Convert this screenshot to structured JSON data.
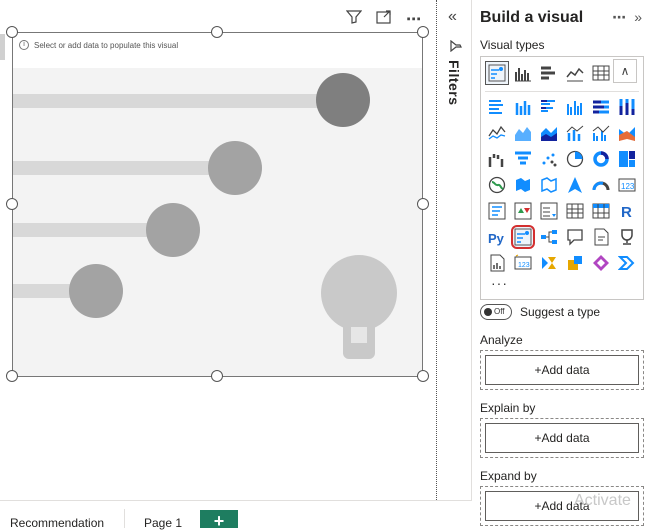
{
  "canvas": {
    "placeholder": "Select or add data to populate this visual",
    "toolbar_icons": [
      "filter-icon",
      "focus-mode-icon",
      "more-options-icon"
    ]
  },
  "filters": {
    "label": "Filters"
  },
  "panel": {
    "title": "Build a visual",
    "visual_types_label": "Visual types",
    "suggest_toggle_state": "Off",
    "suggest_label": "Suggest a type",
    "wells": [
      {
        "label": "Analyze",
        "button": "+Add data"
      },
      {
        "label": "Explain by",
        "button": "+Add data"
      },
      {
        "label": "Expand by",
        "button": "+Add data"
      }
    ],
    "more": "···"
  },
  "pages": {
    "tabs": [
      "Recommendation",
      "Page 1"
    ],
    "add": "+"
  },
  "watermark": "Activate",
  "colors": {
    "accent": "#1e7d60",
    "selected_outline": "#d32f2f",
    "icon_blue": "#118dff"
  }
}
